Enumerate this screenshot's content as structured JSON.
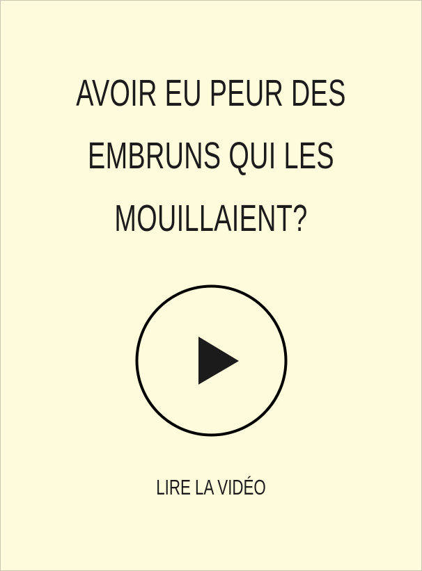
{
  "headline": {
    "lines": [
      "AVOIR EU PEUR DES",
      "EMBRUNS QUI LES",
      "MOUILLAIENT?"
    ]
  },
  "play_button": {
    "icon": "play-icon"
  },
  "cta": {
    "label": "LIRE LA VIDÉO"
  },
  "colors": {
    "background": "#fdfbdc",
    "text": "#1b1b1b",
    "icon": "#000000"
  }
}
